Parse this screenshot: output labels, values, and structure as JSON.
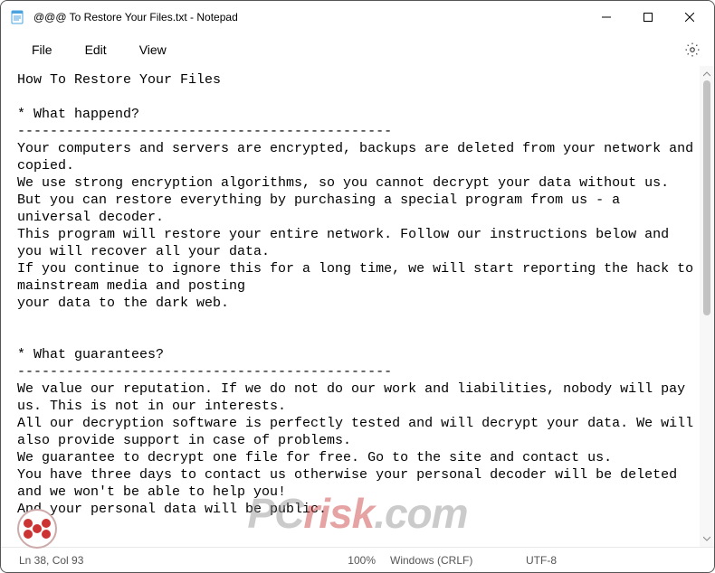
{
  "title": "@@@ To Restore Your Files.txt - Notepad",
  "menus": {
    "file": "File",
    "edit": "Edit",
    "view": "View"
  },
  "body": "How To Restore Your Files\n\n* What happend?\n----------------------------------------------\nYour computers and servers are encrypted, backups are deleted from your network and copied.\nWe use strong encryption algorithms, so you cannot decrypt your data without us.\nBut you can restore everything by purchasing a special program from us - a universal decoder.\nThis program will restore your entire network. Follow our instructions below and you will recover all your data.\nIf you continue to ignore this for a long time, we will start reporting the hack to mainstream media and posting\nyour data to the dark web.\n\n\n* What guarantees?\n----------------------------------------------\nWe value our reputation. If we do not do our work and liabilities, nobody will pay us. This is not in our interests.\nAll our decryption software is perfectly tested and will decrypt your data. We will also provide support in case of problems.\nWe guarantee to decrypt one file for free. Go to the site and contact us.\nYou have three days to contact us otherwise your personal decoder will be deleted and we won't be able to help you!\nAnd your personal data will be public.",
  "status": {
    "position": "Ln 38, Col 93",
    "zoom": "100%",
    "line_ending": "Windows (CRLF)",
    "encoding": "UTF-8"
  },
  "watermark": {
    "brand": "PC",
    "suffix": "risk",
    "tld": ".com"
  }
}
